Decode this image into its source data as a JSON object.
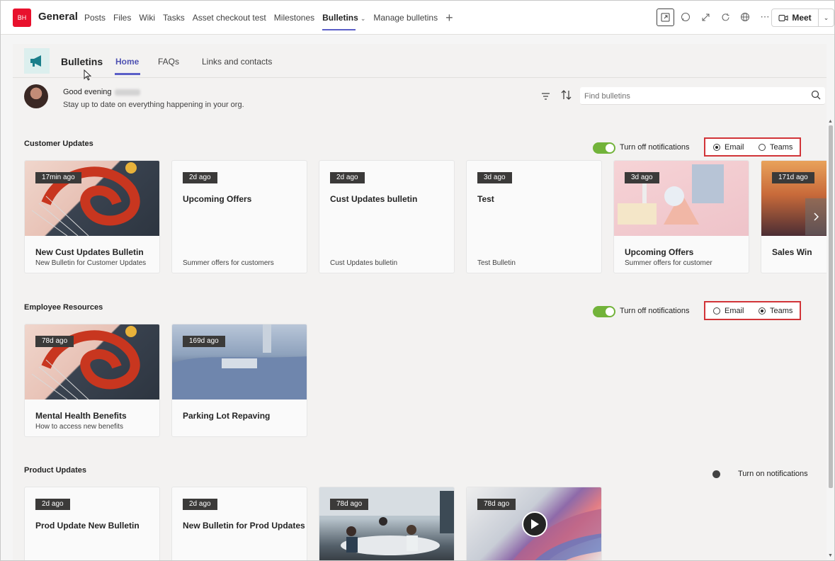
{
  "channel_header": {
    "team_avatar": "BH",
    "title": "General",
    "tabs": [
      "Posts",
      "Files",
      "Wiki",
      "Tasks",
      "Asset checkout test",
      "Milestones",
      "Bulletins",
      "Manage bulletins"
    ],
    "active_tab": "Bulletins",
    "meet_label": "Meet",
    "icons": [
      "popout-icon",
      "chat-icon",
      "expand-icon",
      "refresh-icon",
      "globe-icon",
      "more-icon"
    ]
  },
  "app": {
    "name": "Bulletins",
    "tabs": [
      "Home",
      "FAQs",
      "Links and contacts"
    ],
    "active_tab": "Home",
    "greeting": "Good evening",
    "subtitle": "Stay up to date on everything happening in your org.",
    "search_placeholder": "Find bulletins"
  },
  "sections": [
    {
      "title": "Customer Updates",
      "notification_label": "Turn off notifications",
      "notifications_on": true,
      "channels": [
        {
          "label": "Email",
          "selected": true
        },
        {
          "label": "Teams",
          "selected": false
        }
      ],
      "cards": [
        {
          "badge": "17min ago",
          "title": "New Cust Updates Bulletin",
          "desc": "New Bulletin for Customer Updates",
          "image": "swirl"
        },
        {
          "badge": "2d ago",
          "title": "Upcoming Offers",
          "desc": "Summer offers for customers",
          "image": ""
        },
        {
          "badge": "2d ago",
          "title": "Cust Updates bulletin",
          "desc": "Cust Updates bulletin",
          "image": ""
        },
        {
          "badge": "3d ago",
          "title": "Test",
          "desc": "Test Bulletin",
          "image": ""
        },
        {
          "badge": "3d ago",
          "title": "Upcoming Offers",
          "desc": "Summer offers for customer",
          "image": "shapes"
        },
        {
          "badge": "171d ago",
          "title": "Sales Win",
          "desc": "",
          "image": "sunset"
        }
      ]
    },
    {
      "title": "Employee Resources",
      "notification_label": "Turn off notifications",
      "notifications_on": true,
      "channels": [
        {
          "label": "Email",
          "selected": false
        },
        {
          "label": "Teams",
          "selected": true
        }
      ],
      "cards": [
        {
          "badge": "78d ago",
          "title": "Mental Health Benefits",
          "desc": "How to access new benefits",
          "image": "swirl"
        },
        {
          "badge": "169d ago",
          "title": "Parking Lot Repaving",
          "desc": "",
          "image": "landscape"
        }
      ]
    },
    {
      "title": "Product Updates",
      "notification_label": "Turn on notifications",
      "notifications_on": false,
      "cards": [
        {
          "badge": "2d ago",
          "title": "Prod Update New Bulletin",
          "desc": "",
          "image": ""
        },
        {
          "badge": "2d ago",
          "title": "New Bulletin for Prod Updates",
          "desc": "",
          "image": ""
        },
        {
          "badge": "78d ago",
          "title": "",
          "desc": "",
          "image": "office"
        },
        {
          "badge": "78d ago",
          "title": "",
          "desc": "",
          "image": "silk"
        }
      ]
    }
  ],
  "colors": {
    "accent": "#5b5fc7",
    "toggle_on": "#72b33a",
    "highlight_box": "#d13438",
    "team_avatar": "#e8112d"
  }
}
